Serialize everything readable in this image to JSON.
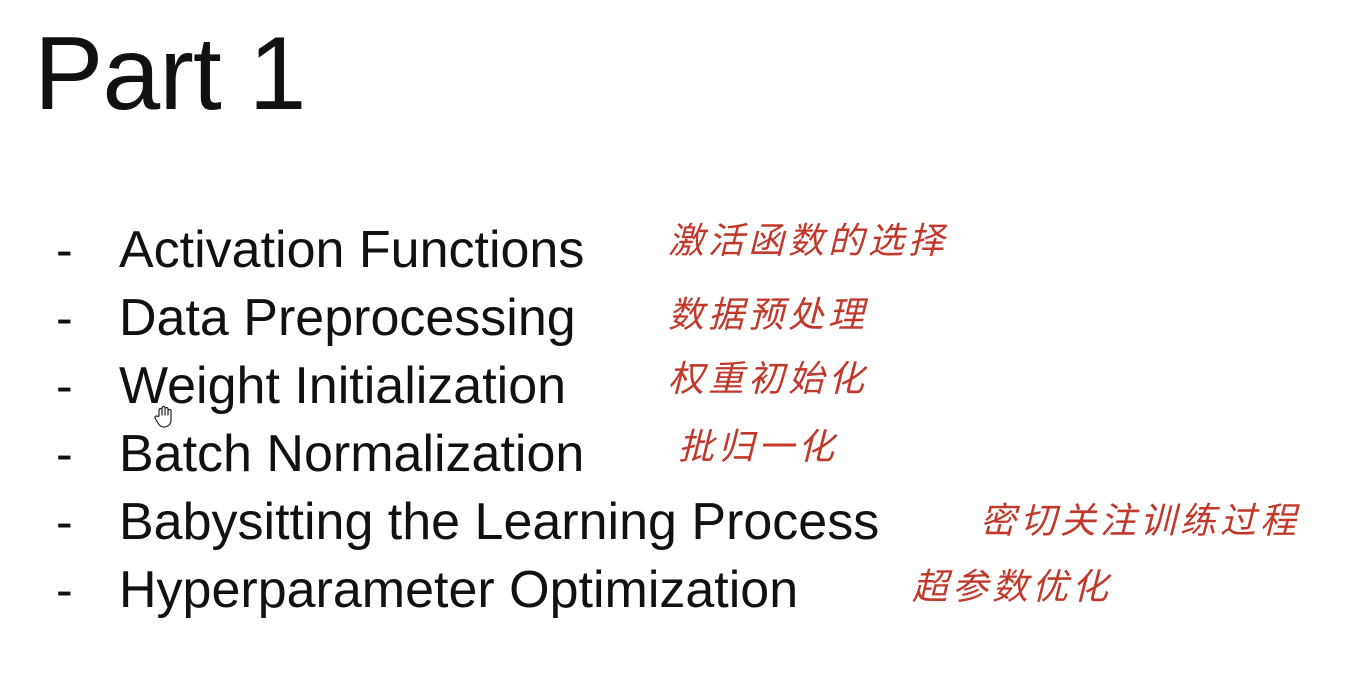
{
  "slide": {
    "title": "Part 1",
    "bullet_marker": "-",
    "items": [
      {
        "text": "Activation Functions",
        "note": "激活函数的选择"
      },
      {
        "text": "Data Preprocessing",
        "note": "数据预处理"
      },
      {
        "text": "Weight Initialization",
        "note": "权重初始化"
      },
      {
        "text": "Batch Normalization",
        "note": "批归一化"
      },
      {
        "text": "Babysitting the Learning Process",
        "note": "密切关注训练过程"
      },
      {
        "text": "Hyperparameter Optimization",
        "note": "超参数优化"
      }
    ]
  },
  "colors": {
    "text": "#111111",
    "annotation": "#c0392b",
    "background": "#ffffff"
  },
  "icons": {
    "cursor": "hand-cursor-icon"
  }
}
